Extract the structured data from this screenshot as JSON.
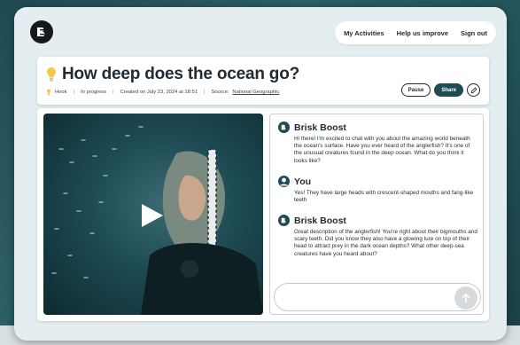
{
  "nav": {
    "items": [
      "My Activities",
      "Help us improve",
      "Sign out"
    ]
  },
  "header": {
    "title": "How deep does the ocean go?",
    "title_icon": "lightbulb-icon",
    "meta": {
      "type": "Hook",
      "status": "In progress",
      "created": "Created on July 23, 2024 at 18:51",
      "source_label": "Source:",
      "source_link": "National Geographic"
    },
    "pause_label": "Pause",
    "share_label": "Share",
    "edit_icon": "pencil-icon"
  },
  "video": {
    "play_icon": "play-icon"
  },
  "chat": {
    "messages": [
      {
        "author": "Brisk Boost",
        "text": "Hi there! I'm excited to chat with you about the amazing world beneath the ocean's surface. Have you ever heard of the anglerfish? It's one of the unusual creatures found in the deep ocean. What do you think it looks like?"
      },
      {
        "author": "You",
        "text": "Yes! They have large heads with crescent-shaped mouths and fang-like teeth"
      },
      {
        "author": "Brisk Boost",
        "text": "Great description of the anglerfish! You're right about their bigmouths and scary teeth. Did you know they also have a glowing lure on top of their head to attract prey in the dark ocean depths? What other deep-sea creatures have you heard about?"
      }
    ],
    "input_placeholder": "",
    "send_icon": "arrow-up-icon"
  },
  "colors": {
    "accent": "#1f4b55",
    "text": "#1f2a33",
    "lightbulb": "#f5c84b"
  }
}
